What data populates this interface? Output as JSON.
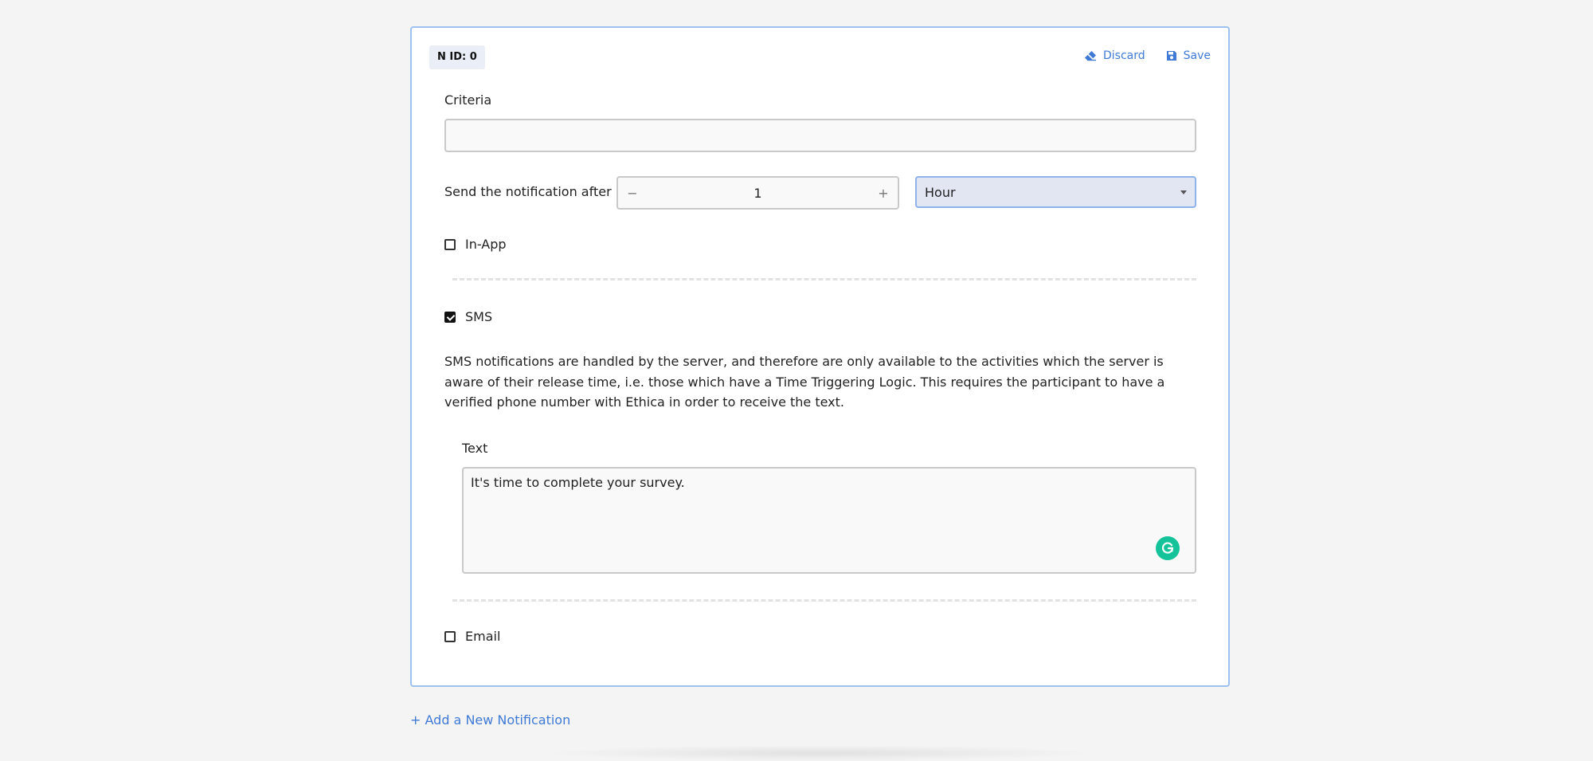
{
  "card": {
    "badge": "N ID: 0",
    "discard_label": "Discard",
    "save_label": "Save"
  },
  "criteria": {
    "label": "Criteria",
    "value": ""
  },
  "delay": {
    "label": "Send the notification after",
    "value": "1",
    "minus": "−",
    "plus": "+",
    "unit": "Hour"
  },
  "in_app": {
    "label": "In-App",
    "checked": false
  },
  "sms": {
    "label": "SMS",
    "checked": true,
    "description": "SMS notifications are handled by the server, and therefore are only available to the activities which the server is aware of their release time, i.e. those which have a Time Triggering Logic. This requires the participant to have a verified phone number with Ethica in order to receive the text.",
    "text_label": "Text",
    "text_value": "It's time to complete your survey."
  },
  "email": {
    "label": "Email",
    "checked": false
  },
  "add_notification": "+ Add a New Notification",
  "colors": {
    "accent": "#3f7ad6",
    "card_border": "#9dc1f0",
    "grammarly": "#15c39a"
  }
}
